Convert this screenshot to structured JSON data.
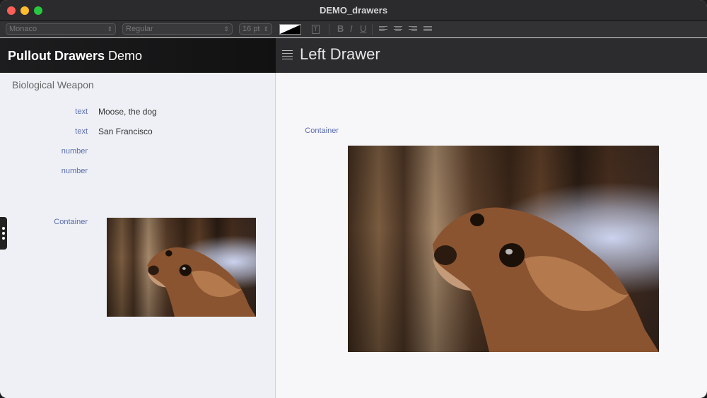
{
  "window": {
    "title": "DEMO_drawers"
  },
  "toolbar": {
    "font_family": "Monaco",
    "font_style": "Regular",
    "font_size": "16 pt",
    "text_icon": "T",
    "bold": "B",
    "italic": "I",
    "underline": "U"
  },
  "left_header": {
    "title_bold": "Pullout Drawers",
    "title_rest": " Demo"
  },
  "right_header": {
    "title": "Left Drawer"
  },
  "left_pane": {
    "section_title": "Biological Weapon",
    "fields": [
      {
        "label": "text",
        "value": "Moose, the dog"
      },
      {
        "label": "text",
        "value": "San Francisco"
      },
      {
        "label": "number",
        "value": ""
      },
      {
        "label": "number",
        "value": ""
      }
    ],
    "container_label": "Container"
  },
  "right_pane": {
    "container_label": "Container"
  },
  "icons": {
    "close": "close-icon",
    "minimize": "minimize-icon",
    "maximize": "maximize-icon",
    "menu": "hamburger-icon",
    "drawer": "drawer-handle-icon"
  }
}
